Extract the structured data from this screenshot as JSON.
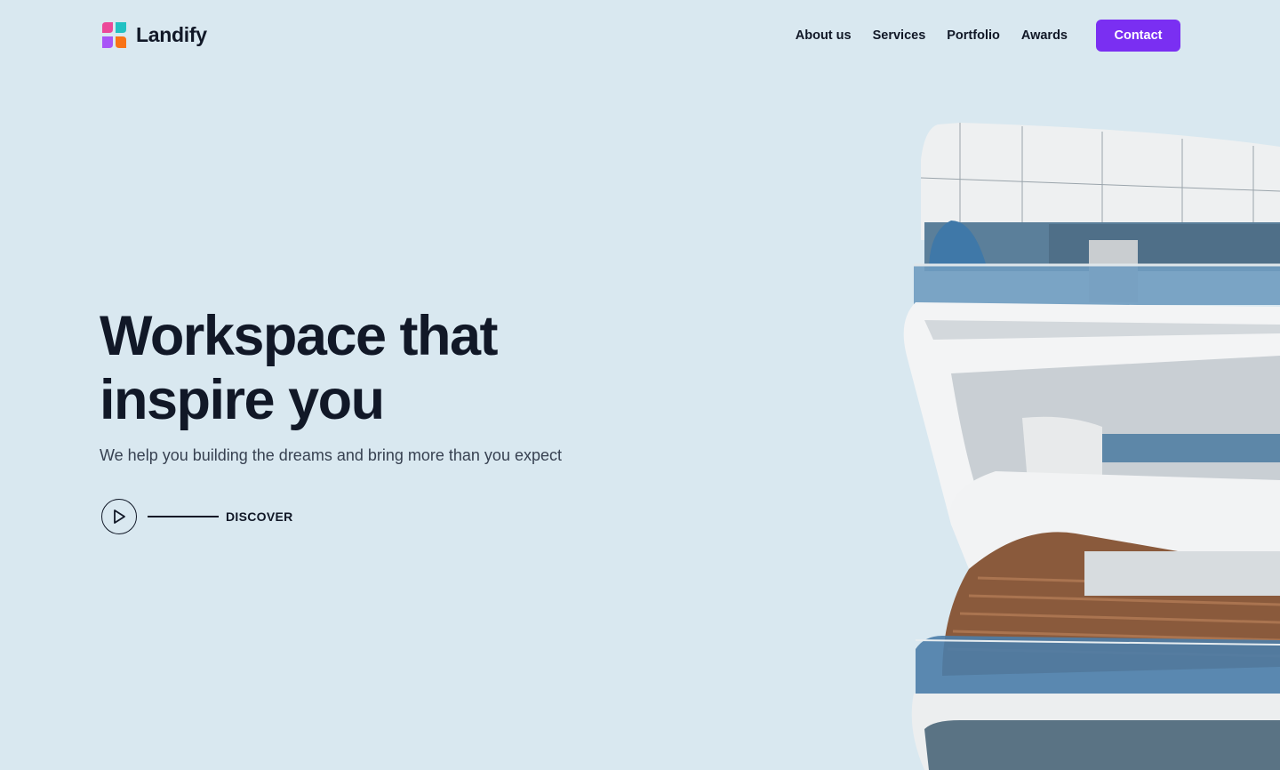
{
  "brand": {
    "name": "Landify",
    "icon": "landify-logo-icon"
  },
  "nav": {
    "links": [
      "About us",
      "Services",
      "Portfolio",
      "Awards"
    ],
    "cta": "Contact"
  },
  "hero": {
    "title_line1": "Workspace that",
    "title_line2": "inspire you",
    "subtitle": "We help you building the dreams and bring more than you expect",
    "discover_label": "DISCOVER",
    "discover_icon": "play-icon"
  },
  "colors": {
    "background": "#d9e8f0",
    "accent": "#7a2ff2",
    "text": "#111827"
  }
}
